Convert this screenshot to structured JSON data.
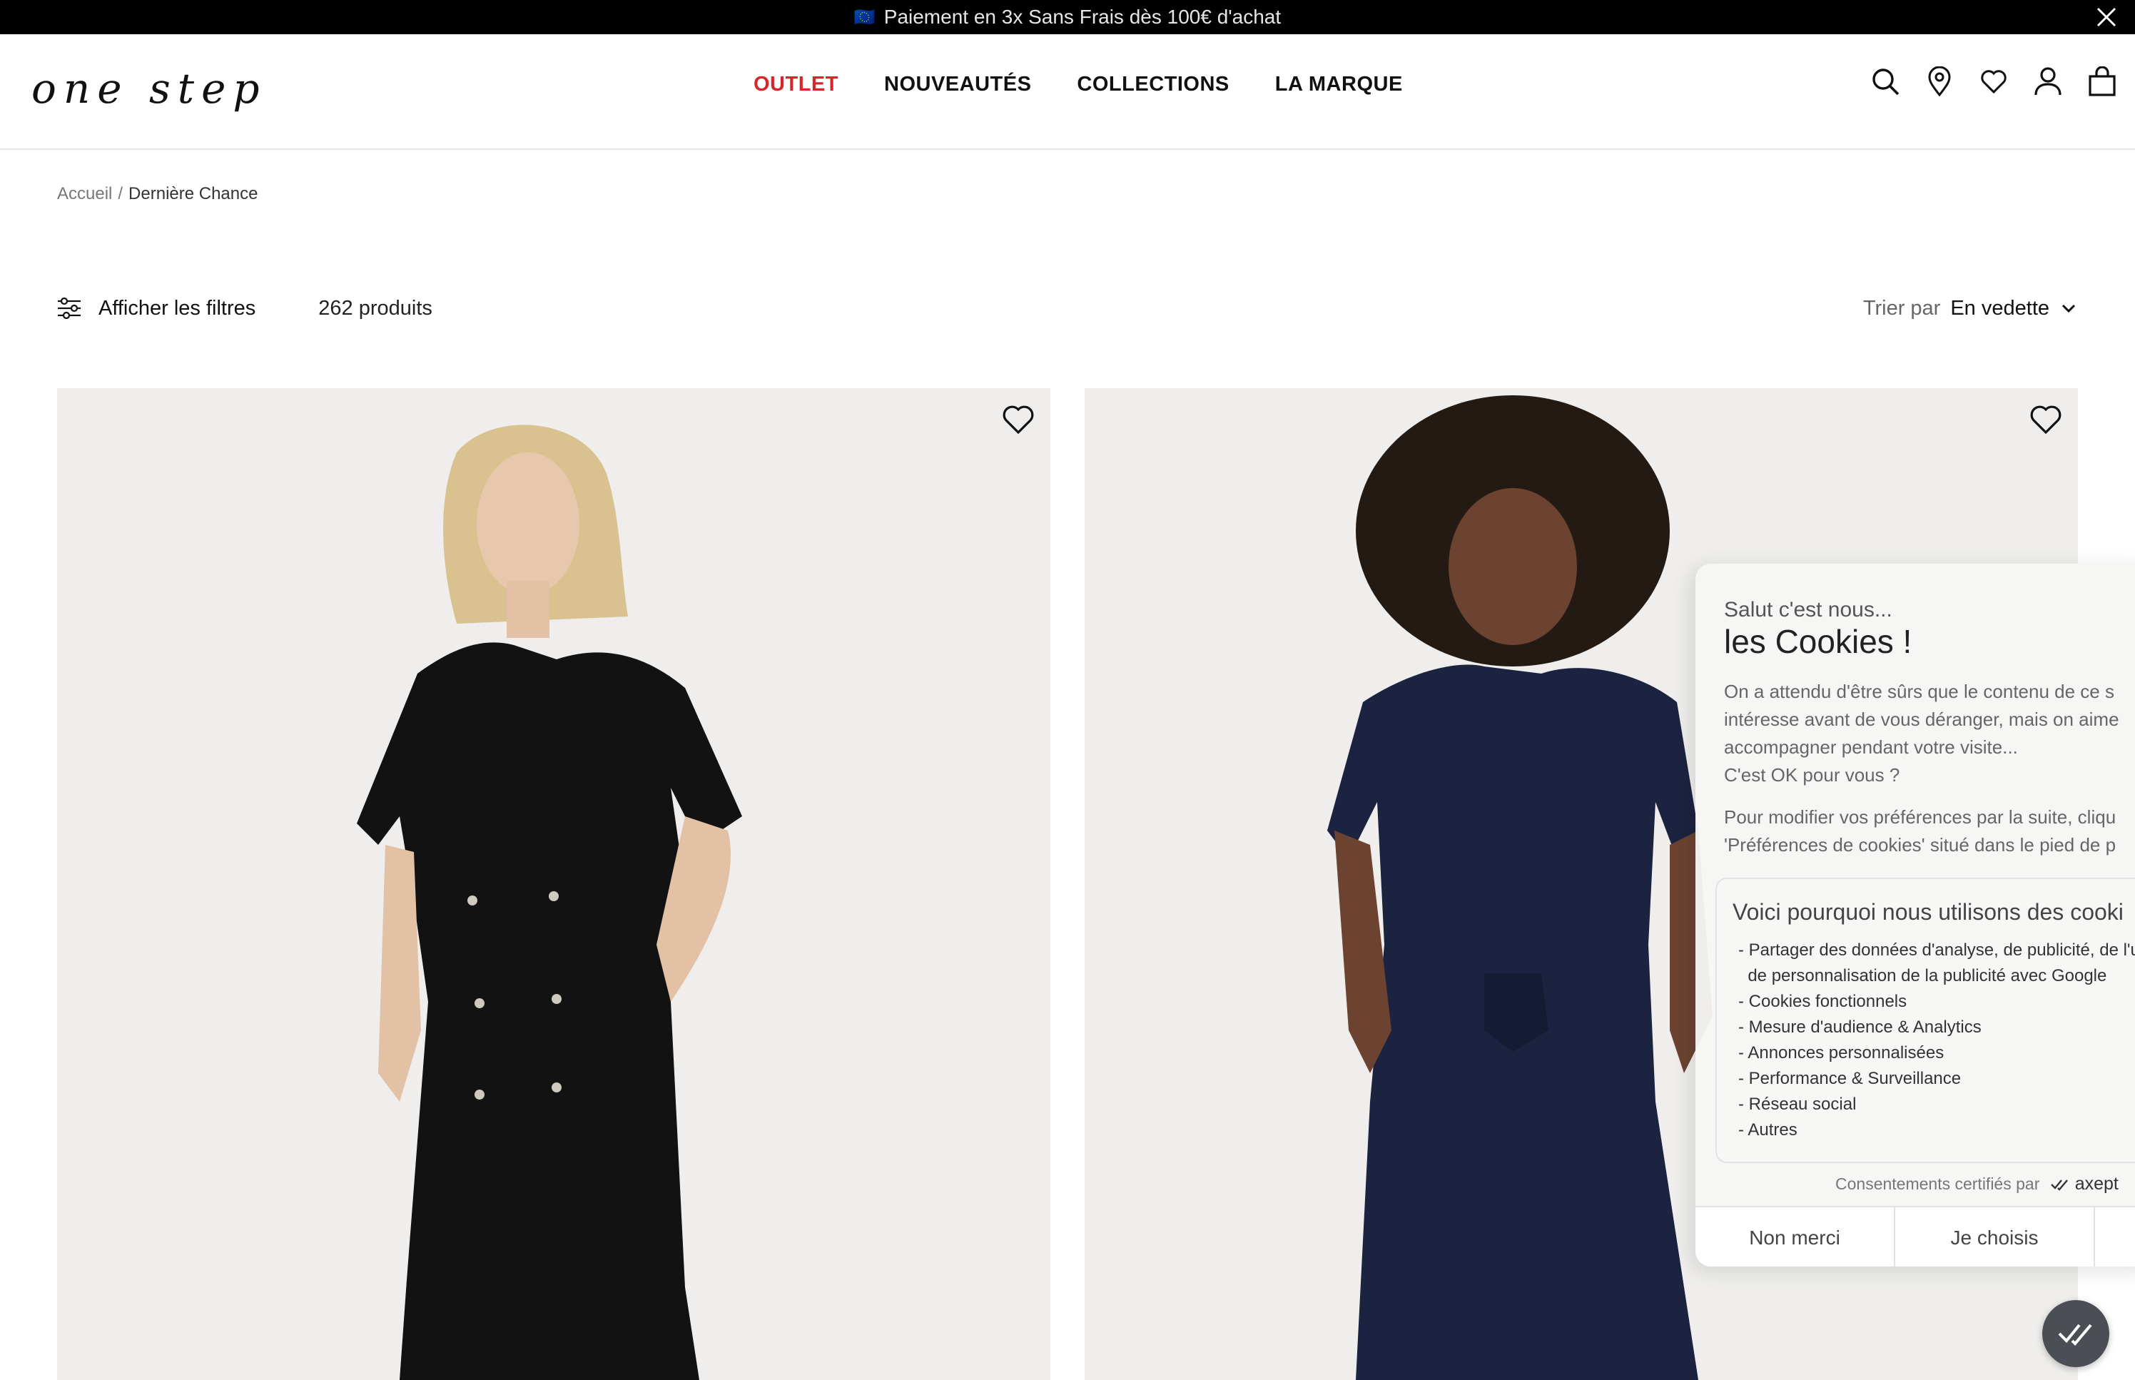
{
  "promo": {
    "flag_icon": "🇪🇺",
    "text": "Paiement en 3x Sans Frais dès 100€ d'achat"
  },
  "header": {
    "logo": "one step",
    "nav": [
      {
        "label": "OUTLET"
      },
      {
        "label": "NOUVEAUTÉS"
      },
      {
        "label": "COLLECTIONS"
      },
      {
        "label": "LA MARQUE"
      }
    ],
    "icons": [
      "search-icon",
      "store-locator-icon",
      "wishlist-icon",
      "account-icon",
      "bag-icon"
    ]
  },
  "breadcrumb": {
    "home": "Accueil",
    "separator": "/",
    "current": "Dernière Chance"
  },
  "toolbar": {
    "filters_label": "Afficher les filtres",
    "count": "262 produits",
    "sort_label": "Trier par",
    "sort_value": "En vedette"
  },
  "products": [
    {
      "image": "woman-black-dress-photo"
    },
    {
      "image": "woman-navy-jumpsuit-photo"
    }
  ],
  "cookie": {
    "pre_title": "Salut c'est nous...",
    "title": "les Cookies !",
    "body_lines": [
      "On a attendu d'être sûrs que le contenu de ce s",
      "intéresse avant de vous déranger, mais on aime",
      "accompagner pendant votre visite...",
      "C'est OK pour vous ?"
    ],
    "prefs_lines": [
      "Pour modifier vos préférences par la suite, cliqu",
      "'Préférences de cookies' situé dans le pied de p"
    ],
    "reasons_title": "Voici pourquoi nous utilisons des cooki",
    "reasons": [
      "- Partager des données d'analyse, de publicité, de l'u",
      "  de personnalisation de la publicité avec Google",
      "- Cookies fonctionnels",
      "- Mesure d'audience & Analytics",
      "- Annonces personnalisées",
      "- Performance & Surveillance",
      "- Réseau social",
      "- Autres"
    ],
    "certified": "Consentements certifiés par",
    "certified_brand": "axept",
    "btn_no": "Non merci",
    "btn_choose": "Je choisis"
  },
  "colors": {
    "accent_outlet": "#d6262c",
    "promo_bg": "#000000",
    "fab_bg": "#4b4f55"
  }
}
